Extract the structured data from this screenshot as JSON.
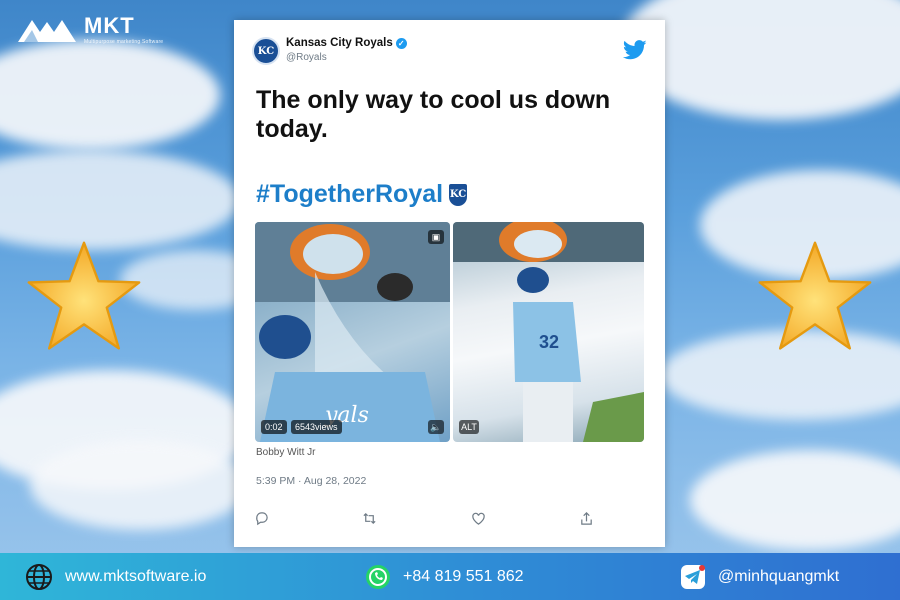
{
  "branding": {
    "logo_text": "MKT",
    "logo_tagline": "Multipurpose marketing Software"
  },
  "tweet": {
    "account_name": "Kansas City Royals",
    "handle": "@Royals",
    "avatar_text": "KC",
    "text": "The only way to cool us down today.",
    "hashtag": "#TogetherRoyal",
    "badge_text": "KC",
    "video_time": "0:02",
    "video_views": "6543views",
    "alt_badge": "ALT",
    "caption": "Bobby Witt Jr",
    "timestamp": "5:39 PM · Aug 28, 2022"
  },
  "footer": {
    "website": "www.mktsoftware.io",
    "phone": "+84 819 551 862",
    "telegram": "@minhquangmkt"
  },
  "colors": {
    "twitter_blue": "#1d9bf0",
    "hashtag_blue": "#1d7ec9",
    "royals_blue": "#1a4f96",
    "footer_start": "#2fb6d8",
    "footer_end": "#2f6fd1",
    "star_gold": "#f6b93b"
  },
  "icons": [
    "globe-icon",
    "whatsapp-icon",
    "telegram-icon",
    "twitter-bird-icon",
    "verified-icon",
    "reply-icon",
    "retweet-icon",
    "like-icon",
    "share-icon",
    "star-icon"
  ]
}
